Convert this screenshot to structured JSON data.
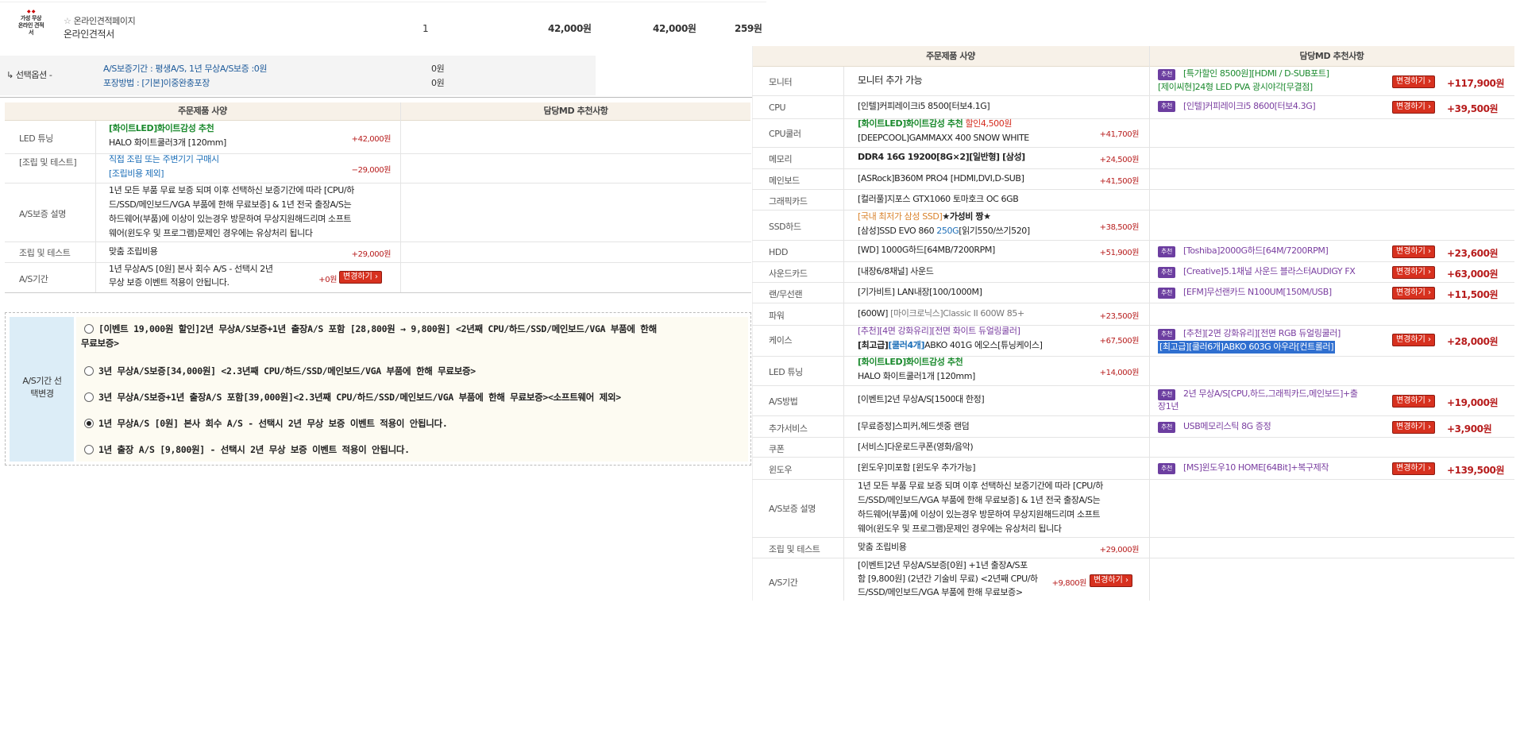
{
  "top_item": {
    "logo_lines": [
      "가성 무상",
      "온라인 견적",
      "서"
    ],
    "tag": "온라인견적페이지",
    "name": "온라인견적서",
    "qty": "1",
    "unit_price": "42,000원",
    "total_price": "42,000원",
    "points": "259원"
  },
  "options": {
    "arrow_label": "↳ 선택옵션 -",
    "rows": [
      {
        "label": "A/S보증기간 : 평생A/S, 1년 무상A/S보증 :0원",
        "price": "0원"
      },
      {
        "label": "포장방법 : [기본]이중완충포장",
        "price": "0원"
      }
    ]
  },
  "left_table": {
    "col1": "주문제품 사양",
    "col2": "담당MD 추천사항",
    "rows": [
      {
        "label": "LED 튜닝",
        "lines": [
          "[화이트LED]화이트감성 추천",
          "HALO 화이트쿨러3개 [120mm]"
        ],
        "price": "+42,000원"
      },
      {
        "label": "[조립 및 테스트]",
        "lines": [
          "직접 조립 또는 주변기기 구매시",
          "[조립비용 제외]"
        ],
        "price": "−29,000원"
      },
      {
        "label": "A/S보증 설명",
        "lines": [
          "1년 모든 부품 무료 보증 되며 이후 선택하신 보증기간에 따라 [CPU/하",
          "드/SSD/메인보드/VGA 부품에 한해 무료보증] & 1년 전국 출장A/S는",
          "하드웨어(부품)에 이상이 있는경우 방문하여 무상지원해드리며 소프트",
          "웨어(윈도우 및 프로그램)문제인 경우에는 유상처리 됩니다"
        ],
        "price": ""
      },
      {
        "label": "조립 및 테스트",
        "lines": [
          "맞춤 조립비용"
        ],
        "price": "+29,000원"
      },
      {
        "label": "A/S기간",
        "lines": [
          "1년 무상A/S [0원] 본사 회수 A/S  - 선택시 2년",
          "무상 보증 이벤트 적용이 안됩니다."
        ],
        "price": "+0원",
        "button": "변경하기 ›"
      }
    ]
  },
  "as_select": {
    "label": "A/S기간 선택변경",
    "options": [
      "[이벤트 19,000원 할인]2년 무상A/S보증+1년 출장A/S 포함 [28,800원 → 9,800원] <2년째 CPU/하드/SSD/메인보드/VGA 부품에 한해",
      "무료보증>",
      "3년 무상A/S보증[34,000원] <2.3년째 CPU/하드/SSD/메인보드/VGA 부품에 한해 무료보증>",
      "3년 무상A/S보증+1년 출장A/S 포함[39,000원]<2.3년째 CPU/하드/SSD/메인보드/VGA 부품에 한해 무료보증><소프트웨어 제외>",
      "1년 무상A/S [0원] 본사 회수 A/S - 선택시 2년 무상 보증 이벤트 적용이 안됩니다.",
      "1년 출장 A/S [9,800원] - 선택시 2년 무상 보증 이벤트 적용이 안됩니다."
    ],
    "selected_index": 3
  },
  "right_table": {
    "col1": "주문제품 사양",
    "col2": "담당MD 추천사항",
    "rec_badge": "추천",
    "button": "변경하기 ›",
    "rows": [
      {
        "label": "모니터",
        "spec": "모니터 추가 가능",
        "price": "",
        "rec": [
          "[특가할인 8500원][HDMI / D-SUB포트]",
          "[제이씨현]24형 LED PVA 광시야각[무결점]"
        ],
        "rec_price": "+117,900원"
      },
      {
        "label": "CPU",
        "spec": "[인텔]커피레이크i5 8500[터보4.1G]",
        "price": "",
        "rec": [
          "[인텔]커피레이크i5 8600[터보4.3G]"
        ],
        "rec_price": "+39,500원"
      },
      {
        "label": "CPU쿨러",
        "spec_a": "[화이트LED]화이트감성 추천",
        "spec_a2": " 할인4,500원",
        "spec": "[DEEPCOOL]GAMMAXX 400 SNOW WHITE",
        "price": "+41,700원"
      },
      {
        "label": "메모리",
        "spec": "DDR4 16G 19200[8G×2][일반형] [삼성]",
        "price": "+24,500원"
      },
      {
        "label": "메인보드",
        "spec": "[ASRock]B360M PRO4 [HDMI,DVI,D-SUB]",
        "price": "+41,500원"
      },
      {
        "label": "그래픽카드",
        "spec": "[컬러풀]지포스 GTX1060 토마호크 OC 6GB",
        "price": ""
      },
      {
        "label": "SSD하드",
        "spec_a": "[국내 최저가 삼성 SSD]",
        "spec_a2": "★가성비 짱★",
        "spec": "[삼성]SSD EVO 860 ",
        "spec_b": "250G",
        "spec_c": "[읽기550/쓰기520]",
        "price": "+38,500원"
      },
      {
        "label": "HDD",
        "spec": "[WD] 1000G하드[64MB/7200RPM]",
        "price": "+51,900원",
        "rec": [
          "[Toshiba]2000G하드[64M/7200RPM]"
        ],
        "rec_price": "+23,600원"
      },
      {
        "label": "사운드카드",
        "spec": "[내장6/8채널] 사운드",
        "price": "",
        "rec": [
          "[Creative]5.1채널 사운드 블라스터AUDIGY FX"
        ],
        "rec_price": "+63,000원"
      },
      {
        "label": "랜/무선랜",
        "spec": "[기가비트] LAN내장[100/1000M]",
        "price": "",
        "rec": [
          "[EFM]무선랜카드 N100UM[150M/USB]"
        ],
        "rec_price": "+11,500원"
      },
      {
        "label": "파워",
        "spec": "[600W] ",
        "spec_b": "[마이크로닉스]Classic II 600W 85+",
        "price": "+23,500원"
      },
      {
        "label": "케이스",
        "spec_a": "[추천][4면 강화유리][전면 화이트 듀얼링쿨러]",
        "spec": "[최고급]",
        "spec_b": "[쿨러4개]",
        "spec_c": "ABKO 401G 에오스[튜닝케이스]",
        "price": "+67,500원",
        "rec": [
          "[추천][2면 강화유리][전면 RGB 듀얼링쿨러]",
          "[최고급][쿨러6개]ABKO 603G 아우라[컨트롤러]"
        ],
        "rec_price": "+28,000원"
      },
      {
        "label": "LED 튜닝",
        "spec_a": "[화이트LED]화이트감성 추천",
        "spec": "HALO 화이트쿨러1개 [120mm]",
        "price": "+14,000원"
      },
      {
        "label": "A/S방법",
        "spec": "[이벤트]2년 무상A/S[1500대 한정]",
        "price": "",
        "rec": [
          "2년 무상A/S[CPU,하드,그래픽카드,메인보드]+출",
          "장1년"
        ],
        "rec_price": "+19,000원"
      },
      {
        "label": "추가서비스",
        "spec": "[무료증정]스피커,헤드셋중 랜덤",
        "price": "",
        "rec": [
          "USB메모리스틱 8G 증정"
        ],
        "rec_price": "+3,900원"
      },
      {
        "label": "쿠폰",
        "spec": "[서비스]다운로드쿠폰(영화/음악)",
        "price": ""
      },
      {
        "label": "윈도우",
        "spec": "[윈도우]미포함 [윈도우 추가가능]",
        "price": "",
        "rec": [
          "[MS]윈도우10 HOME[64Bit]+복구제작"
        ],
        "rec_price": "+139,500원"
      },
      {
        "label": "A/S보증 설명",
        "lines": [
          "1년 모든 부품 무료 보증 되며 이후 선택하신 보증기간에 따라 [CPU/하",
          "드/SSD/메인보드/VGA 부품에 한해 무료보증] & 1년 전국 출장A/S는",
          "하드웨어(부품)에 이상이 있는경우 방문하여 무상지원해드리며 소프트",
          "웨어(윈도우 및 프로그램)문제인 경우에는 유상처리 됩니다"
        ]
      },
      {
        "label": "조립 및 테스트",
        "spec": "맞춤 조립비용",
        "price": "+29,000원"
      },
      {
        "label": "A/S기간",
        "lines": [
          "[이벤트]2년 무상A/S보증[0원] +1년 출장A/S포",
          "함 [9,800원] (2년간 기술비 무료) <2년째 CPU/하",
          "드/SSD/메인보드/VGA 부품에 한해 무료보증>"
        ],
        "price": "+9,800원",
        "button": "변경하기 ›"
      }
    ]
  }
}
